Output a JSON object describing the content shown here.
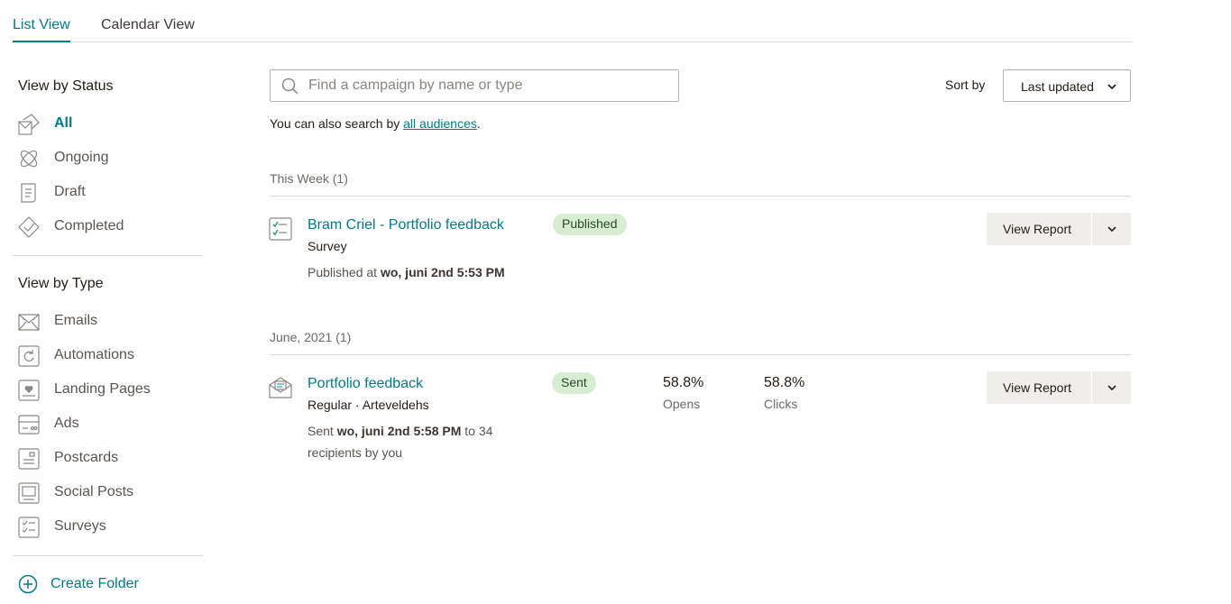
{
  "tabs": [
    {
      "label": "List View",
      "active": true
    },
    {
      "label": "Calendar View",
      "active": false
    }
  ],
  "sidebar": {
    "status_heading": "View by Status",
    "status_items": [
      {
        "label": "All",
        "icon": "campaign-all-icon",
        "active": true
      },
      {
        "label": "Ongoing",
        "icon": "ongoing-icon"
      },
      {
        "label": "Draft",
        "icon": "draft-icon"
      },
      {
        "label": "Completed",
        "icon": "completed-icon"
      }
    ],
    "type_heading": "View by Type",
    "type_items": [
      {
        "label": "Emails",
        "icon": "email-icon"
      },
      {
        "label": "Automations",
        "icon": "automation-icon"
      },
      {
        "label": "Landing Pages",
        "icon": "landing-page-icon"
      },
      {
        "label": "Ads",
        "icon": "ads-icon"
      },
      {
        "label": "Postcards",
        "icon": "postcard-icon"
      },
      {
        "label": "Social Posts",
        "icon": "social-post-icon"
      },
      {
        "label": "Surveys",
        "icon": "survey-icon"
      }
    ],
    "create_folder": "Create Folder"
  },
  "search": {
    "placeholder": "Find a campaign by name or type",
    "value": "",
    "hint_prefix": "You can also search by ",
    "hint_link": "all audiences",
    "hint_suffix": "."
  },
  "sort": {
    "label": "Sort by",
    "selected": "Last updated"
  },
  "groups": [
    {
      "heading": "This Week (1)",
      "campaigns": [
        {
          "title": "Bram Criel - Portfolio feedback",
          "type": "Survey",
          "meta_prefix": "Published at ",
          "meta_bold": "wo, juni 2nd 5:53 PM",
          "status": "Published",
          "action": "View Report"
        }
      ]
    },
    {
      "heading": "June, 2021 (1)",
      "campaigns": [
        {
          "title": "Portfolio feedback",
          "type": "Regular · Arteveldehs",
          "meta_prefix": "Sent ",
          "meta_bold": "wo, juni 2nd 5:58 PM",
          "meta_suffix": " to 34",
          "meta_line2": "recipients by you",
          "status": "Sent",
          "opens_value": "58.8%",
          "opens_label": "Opens",
          "clicks_value": "58.8%",
          "clicks_label": "Clicks",
          "action": "View Report"
        }
      ]
    }
  ],
  "colors": {
    "accent": "#007c89",
    "badge_bg": "#d7ecd2",
    "button_bg": "#efeeea",
    "divider": "#d9d9d9"
  }
}
